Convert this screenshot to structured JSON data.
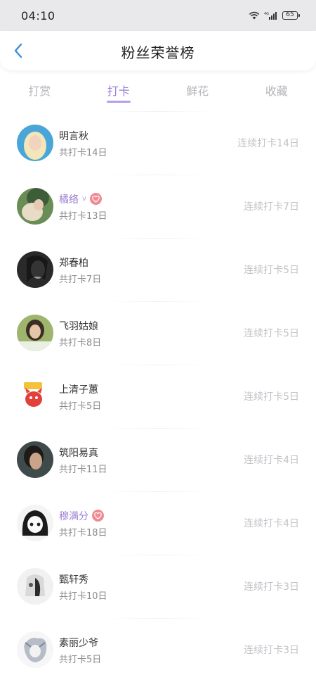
{
  "status_bar": {
    "time": "04:10",
    "network": "4G",
    "battery": "65"
  },
  "header": {
    "title": "粉丝荣誉榜"
  },
  "tabs": [
    {
      "label": "打赏",
      "active": false
    },
    {
      "label": "打卡",
      "active": true
    },
    {
      "label": "鲜花",
      "active": false
    },
    {
      "label": "收藏",
      "active": false
    }
  ],
  "fans": [
    {
      "name": "明言秋",
      "total": "共打卡14日",
      "streak": "连续打卡14日",
      "vip": false
    },
    {
      "name": "橘络",
      "total": "共打卡13日",
      "streak": "连续打卡7日",
      "vip": true,
      "vip_mark": "ⅴ"
    },
    {
      "name": "郑春柏",
      "total": "共打卡7日",
      "streak": "连续打卡5日",
      "vip": false
    },
    {
      "name": "飞羽姑娘",
      "total": "共打卡8日",
      "streak": "连续打卡5日",
      "vip": false
    },
    {
      "name": "上清子蕙",
      "total": "共打卡5日",
      "streak": "连续打卡5日",
      "vip": false
    },
    {
      "name": "筑阳易真",
      "total": "共打卡11日",
      "streak": "连续打卡4日",
      "vip": false
    },
    {
      "name": "穆满分",
      "total": "共打卡18日",
      "streak": "连续打卡4日",
      "vip": true,
      "vip_mark": ""
    },
    {
      "name": "甄轩秀",
      "total": "共打卡10日",
      "streak": "连续打卡3日",
      "vip": false
    },
    {
      "name": "素丽少爷",
      "total": "共打卡5日",
      "streak": "连续打卡3日",
      "vip": false
    }
  ],
  "colors": {
    "accent": "#9b7fd4",
    "badge": "#f08a92",
    "muted": "#c2c2c8"
  }
}
